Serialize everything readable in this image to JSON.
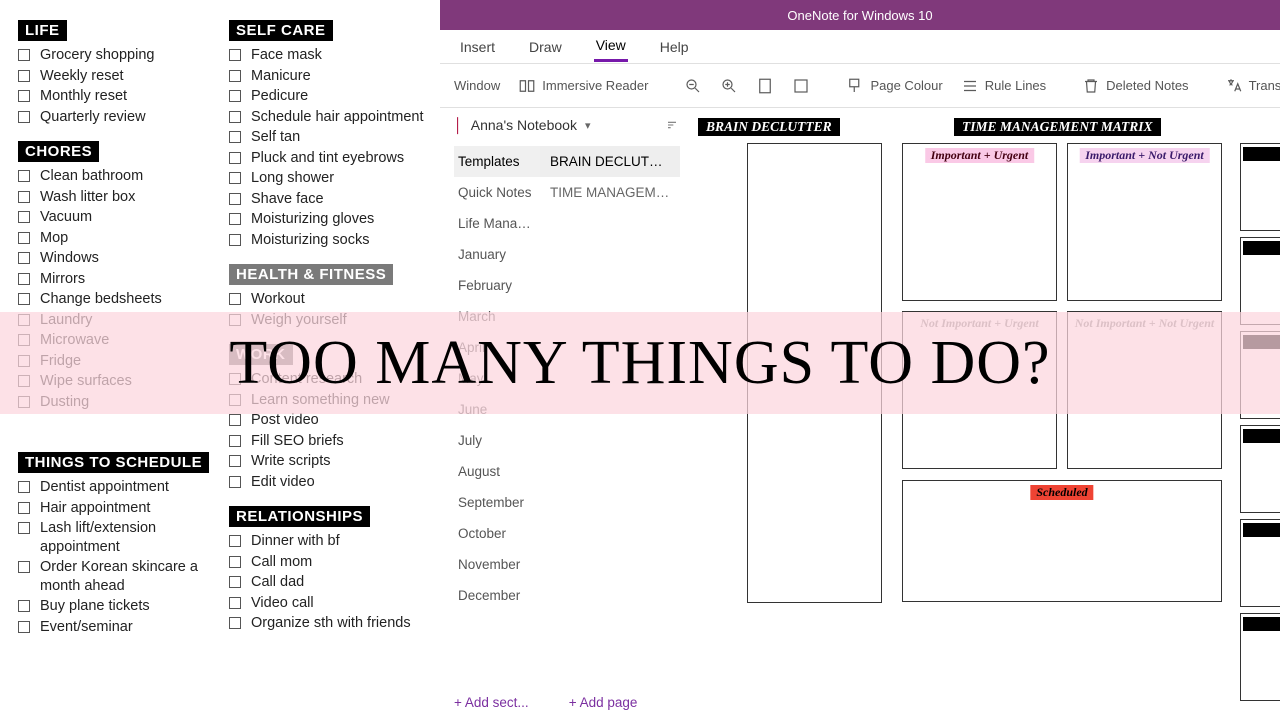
{
  "app_title": "OneNote for Windows 10",
  "overlay_text": "TOO MANY THINGS TO DO?",
  "tabs": {
    "insert": "Insert",
    "draw": "Draw",
    "view": "View",
    "help": "Help"
  },
  "ribbon": {
    "window": "Window",
    "immersive": "Immersive Reader",
    "pagecolour": "Page Colour",
    "rulelines": "Rule Lines",
    "deleted": "Deleted Notes",
    "translate": "Translat"
  },
  "notebook_name": "Anna's Notebook",
  "sections": [
    "Templates",
    "Quick Notes",
    "Life Manag...",
    "January",
    "February",
    "March",
    "April",
    "May",
    "June",
    "July",
    "August",
    "September",
    "October",
    "November",
    "December"
  ],
  "add_section": "Add sect...",
  "pages": [
    "BRAIN DECLUTTER",
    "TIME MANAGEME..."
  ],
  "add_page": "Add page",
  "page_labels": {
    "brain": "BRAIN DECLUTTER",
    "matrix": "TIME MANAGEMENT MATRIX"
  },
  "matrix_quadrants": {
    "q1": "Important + Urgent",
    "q2": "Important + Not Urgent",
    "q3": "Not Important + Urgent",
    "q4": "Not Important + Not Urgent",
    "scheduled": "Scheduled"
  },
  "checklist": {
    "life": {
      "heading": "LIFE",
      "items": [
        "Grocery shopping",
        "Weekly reset",
        "Monthly reset",
        "Quarterly review"
      ]
    },
    "chores": {
      "heading": "CHORES",
      "items": [
        "Clean bathroom",
        "Wash litter box",
        "Vacuum",
        "Mop",
        "Windows",
        "Mirrors",
        "Change bedsheets",
        "Laundry",
        "Microwave",
        "Fridge",
        "Wipe surfaces",
        "Dusting"
      ]
    },
    "schedule": {
      "heading": "THINGS TO SCHEDULE",
      "items": [
        "Dentist appointment",
        "Hair appointment",
        "Lash lift/extension appointment",
        "Order Korean skincare a month ahead",
        "Buy plane tickets",
        "Event/seminar"
      ]
    },
    "selfcare": {
      "heading": "SELF CARE",
      "items": [
        "Face mask",
        "Manicure",
        "Pedicure",
        "Schedule hair appointment",
        "Self tan",
        "Pluck and tint eyebrows",
        "Long shower",
        "Shave face",
        "Moisturizing gloves",
        "Moisturizing socks"
      ]
    },
    "health": {
      "heading": "HEALTH & FITNESS",
      "items": [
        "Workout",
        "Weigh yourself"
      ]
    },
    "work": {
      "heading": "WORK",
      "items": [
        "Content research",
        "Learn something new",
        "Post video",
        "Fill SEO briefs",
        "Write scripts",
        "Edit video"
      ]
    },
    "relationships": {
      "heading": "RELATIONSHIPS",
      "items": [
        "Dinner with bf",
        "Call mom",
        "Call dad",
        "Video call",
        "Organize sth with friends"
      ]
    }
  }
}
